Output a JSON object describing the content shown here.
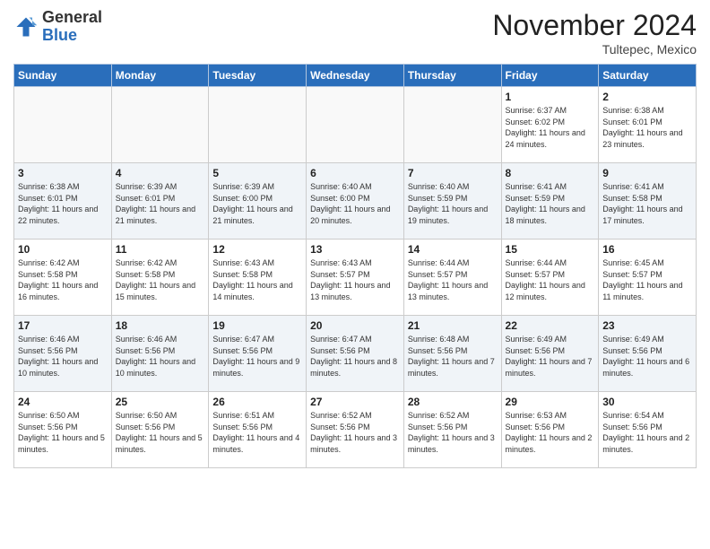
{
  "header": {
    "logo_general": "General",
    "logo_blue": "Blue",
    "month_title": "November 2024",
    "location": "Tultepec, Mexico"
  },
  "days_of_week": [
    "Sunday",
    "Monday",
    "Tuesday",
    "Wednesday",
    "Thursday",
    "Friday",
    "Saturday"
  ],
  "weeks": [
    [
      {
        "day": "",
        "info": ""
      },
      {
        "day": "",
        "info": ""
      },
      {
        "day": "",
        "info": ""
      },
      {
        "day": "",
        "info": ""
      },
      {
        "day": "",
        "info": ""
      },
      {
        "day": "1",
        "info": "Sunrise: 6:37 AM\nSunset: 6:02 PM\nDaylight: 11 hours and 24 minutes."
      },
      {
        "day": "2",
        "info": "Sunrise: 6:38 AM\nSunset: 6:01 PM\nDaylight: 11 hours and 23 minutes."
      }
    ],
    [
      {
        "day": "3",
        "info": "Sunrise: 6:38 AM\nSunset: 6:01 PM\nDaylight: 11 hours and 22 minutes."
      },
      {
        "day": "4",
        "info": "Sunrise: 6:39 AM\nSunset: 6:01 PM\nDaylight: 11 hours and 21 minutes."
      },
      {
        "day": "5",
        "info": "Sunrise: 6:39 AM\nSunset: 6:00 PM\nDaylight: 11 hours and 21 minutes."
      },
      {
        "day": "6",
        "info": "Sunrise: 6:40 AM\nSunset: 6:00 PM\nDaylight: 11 hours and 20 minutes."
      },
      {
        "day": "7",
        "info": "Sunrise: 6:40 AM\nSunset: 5:59 PM\nDaylight: 11 hours and 19 minutes."
      },
      {
        "day": "8",
        "info": "Sunrise: 6:41 AM\nSunset: 5:59 PM\nDaylight: 11 hours and 18 minutes."
      },
      {
        "day": "9",
        "info": "Sunrise: 6:41 AM\nSunset: 5:58 PM\nDaylight: 11 hours and 17 minutes."
      }
    ],
    [
      {
        "day": "10",
        "info": "Sunrise: 6:42 AM\nSunset: 5:58 PM\nDaylight: 11 hours and 16 minutes."
      },
      {
        "day": "11",
        "info": "Sunrise: 6:42 AM\nSunset: 5:58 PM\nDaylight: 11 hours and 15 minutes."
      },
      {
        "day": "12",
        "info": "Sunrise: 6:43 AM\nSunset: 5:58 PM\nDaylight: 11 hours and 14 minutes."
      },
      {
        "day": "13",
        "info": "Sunrise: 6:43 AM\nSunset: 5:57 PM\nDaylight: 11 hours and 13 minutes."
      },
      {
        "day": "14",
        "info": "Sunrise: 6:44 AM\nSunset: 5:57 PM\nDaylight: 11 hours and 13 minutes."
      },
      {
        "day": "15",
        "info": "Sunrise: 6:44 AM\nSunset: 5:57 PM\nDaylight: 11 hours and 12 minutes."
      },
      {
        "day": "16",
        "info": "Sunrise: 6:45 AM\nSunset: 5:57 PM\nDaylight: 11 hours and 11 minutes."
      }
    ],
    [
      {
        "day": "17",
        "info": "Sunrise: 6:46 AM\nSunset: 5:56 PM\nDaylight: 11 hours and 10 minutes."
      },
      {
        "day": "18",
        "info": "Sunrise: 6:46 AM\nSunset: 5:56 PM\nDaylight: 11 hours and 10 minutes."
      },
      {
        "day": "19",
        "info": "Sunrise: 6:47 AM\nSunset: 5:56 PM\nDaylight: 11 hours and 9 minutes."
      },
      {
        "day": "20",
        "info": "Sunrise: 6:47 AM\nSunset: 5:56 PM\nDaylight: 11 hours and 8 minutes."
      },
      {
        "day": "21",
        "info": "Sunrise: 6:48 AM\nSunset: 5:56 PM\nDaylight: 11 hours and 7 minutes."
      },
      {
        "day": "22",
        "info": "Sunrise: 6:49 AM\nSunset: 5:56 PM\nDaylight: 11 hours and 7 minutes."
      },
      {
        "day": "23",
        "info": "Sunrise: 6:49 AM\nSunset: 5:56 PM\nDaylight: 11 hours and 6 minutes."
      }
    ],
    [
      {
        "day": "24",
        "info": "Sunrise: 6:50 AM\nSunset: 5:56 PM\nDaylight: 11 hours and 5 minutes."
      },
      {
        "day": "25",
        "info": "Sunrise: 6:50 AM\nSunset: 5:56 PM\nDaylight: 11 hours and 5 minutes."
      },
      {
        "day": "26",
        "info": "Sunrise: 6:51 AM\nSunset: 5:56 PM\nDaylight: 11 hours and 4 minutes."
      },
      {
        "day": "27",
        "info": "Sunrise: 6:52 AM\nSunset: 5:56 PM\nDaylight: 11 hours and 3 minutes."
      },
      {
        "day": "28",
        "info": "Sunrise: 6:52 AM\nSunset: 5:56 PM\nDaylight: 11 hours and 3 minutes."
      },
      {
        "day": "29",
        "info": "Sunrise: 6:53 AM\nSunset: 5:56 PM\nDaylight: 11 hours and 2 minutes."
      },
      {
        "day": "30",
        "info": "Sunrise: 6:54 AM\nSunset: 5:56 PM\nDaylight: 11 hours and 2 minutes."
      }
    ]
  ]
}
